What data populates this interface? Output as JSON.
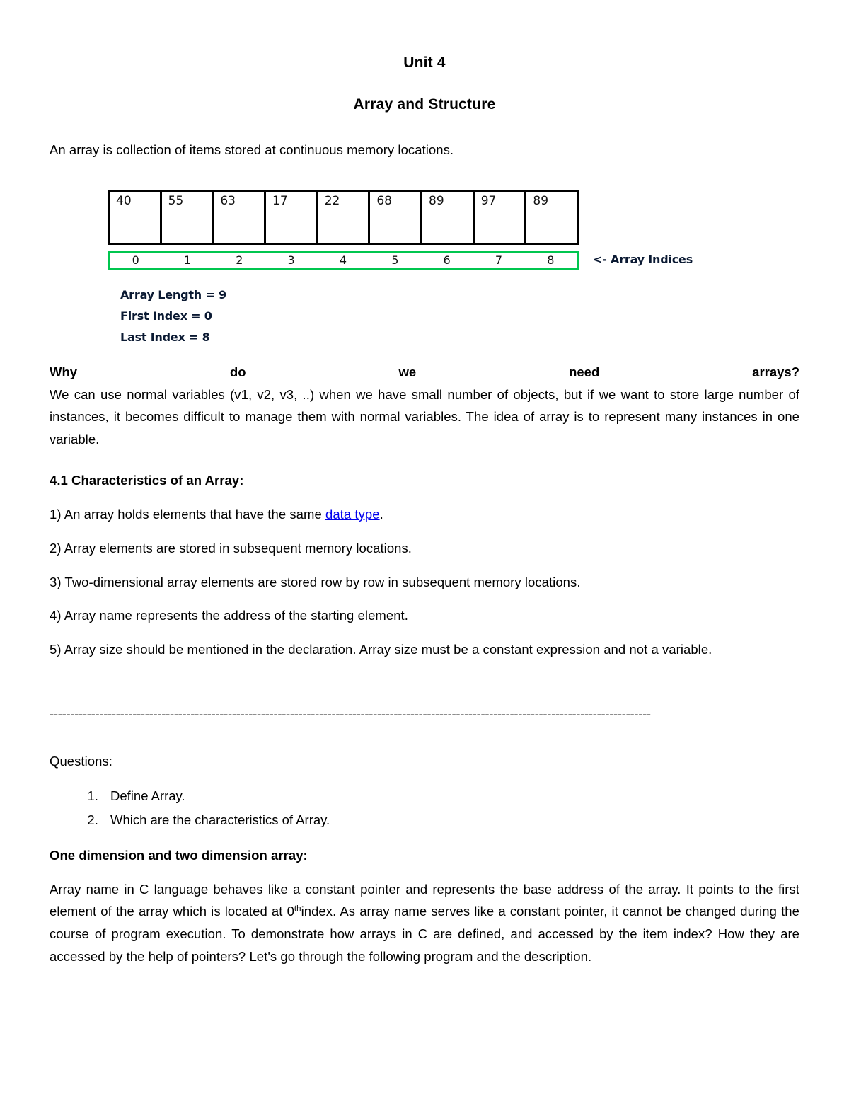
{
  "document": {
    "title": "Unit 4",
    "subtitle": "Array and Structure",
    "intro": "An array is collection of items stored at continuous memory locations."
  },
  "figure": {
    "values": [
      "40",
      "55",
      "63",
      "17",
      "22",
      "68",
      "89",
      "97",
      "89"
    ],
    "indices": [
      "0",
      "1",
      "2",
      "3",
      "4",
      "5",
      "6",
      "7",
      "8"
    ],
    "indices_label": "<- Array Indices",
    "notes": [
      "Array Length = 9",
      "First Index = 0",
      "Last Index = 8"
    ],
    "border_color": "#000000",
    "index_border_color": "#00c64f"
  },
  "why_section": {
    "heading": "Why do we need arrays?",
    "heading_words": [
      "Why",
      "do",
      "we",
      "need",
      "arrays?"
    ],
    "body": "We can use normal variables (v1, v2, v3, ..) when we have small number of objects, but if we want to store large number of instances, it becomes difficult to manage them with normal variables. The idea of array is to represent many instances in one variable."
  },
  "characteristics": {
    "heading": "4.1 Characteristics of an Array:",
    "items": [
      {
        "prefix": "1) An array holds elements that have the same ",
        "link": "data type",
        "suffix": "."
      },
      {
        "prefix": "2) Array elements are stored in subsequent memory locations.",
        "link": "",
        "suffix": ""
      },
      {
        "prefix": "3) Two-dimensional array elements are stored row by row in subsequent memory locations.",
        "link": "",
        "suffix": ""
      },
      {
        "prefix": "4) Array name represents the address of the starting element.",
        "link": "",
        "suffix": ""
      },
      {
        "prefix": "5) Array size should be mentioned in the declaration. Array size must be a constant expression and not a variable.",
        "link": "",
        "suffix": ""
      }
    ],
    "link_color": "#0000ee"
  },
  "divider": "-------------------------------------------------------------------------------------------------------------------------------------------------",
  "questions": {
    "label": "Questions:",
    "items": [
      "Define Array.",
      "Which are the characteristics of Array."
    ]
  },
  "dimensions_section": {
    "heading": "One dimension and two dimension array:",
    "para_part1": "Array name in C language behaves like a constant pointer and represents the base address of the array. It points to the first element of the array which is located at 0",
    "superscript": "th",
    "para_part2": "index. As array name serves like a constant pointer, it cannot be changed during the course of program execution. To demonstrate how arrays in C are defined, and accessed by the item index? How they are accessed by the help of pointers? Let's go through the following program and the description."
  }
}
